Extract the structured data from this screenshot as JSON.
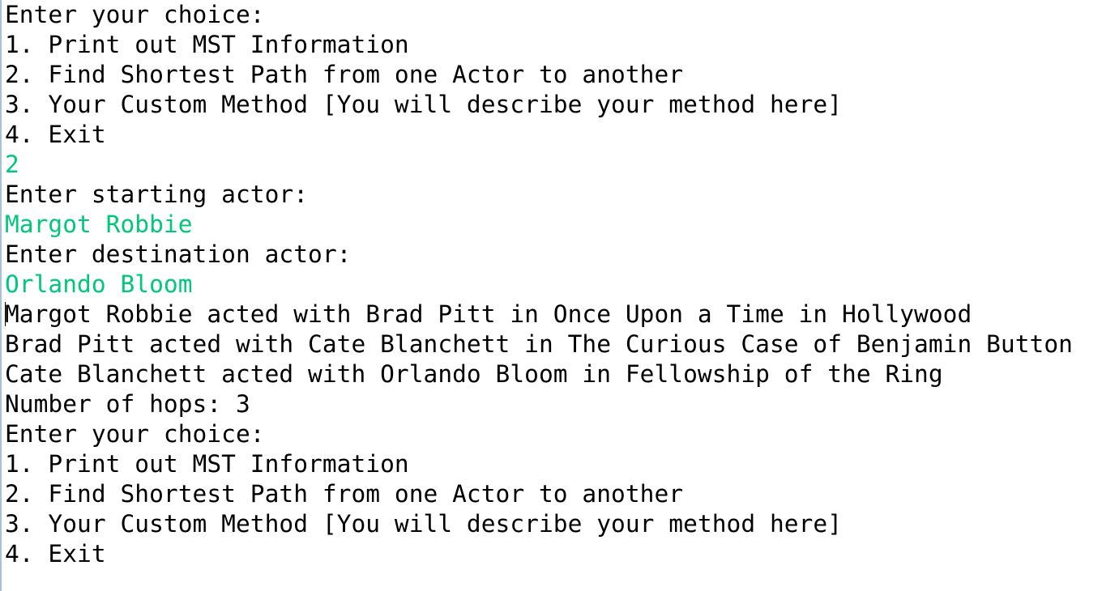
{
  "colors": {
    "output_text": "#000000",
    "user_input": "#00c87a",
    "background": "#ffffff",
    "left_border": "#a7c1d9"
  },
  "console": {
    "lines": [
      {
        "text": "Enter your choice:",
        "kind": "output"
      },
      {
        "text": "1. Print out MST Information",
        "kind": "output"
      },
      {
        "text": "2. Find Shortest Path from one Actor to another",
        "kind": "output"
      },
      {
        "text": "3. Your Custom Method [You will describe your method here]",
        "kind": "output"
      },
      {
        "text": "4. Exit",
        "kind": "output"
      },
      {
        "text": "2",
        "kind": "input"
      },
      {
        "text": "Enter starting actor:",
        "kind": "output"
      },
      {
        "text": "Margot Robbie",
        "kind": "input"
      },
      {
        "text": "Enter destination actor:",
        "kind": "output"
      },
      {
        "text": "Orlando Bloom",
        "kind": "input"
      },
      {
        "text": "Margot Robbie acted with Brad Pitt in Once Upon a Time in Hollywood",
        "kind": "output"
      },
      {
        "text": "Brad Pitt acted with Cate Blanchett in The Curious Case of Benjamin Button",
        "kind": "output"
      },
      {
        "text": "Cate Blanchett acted with Orlando Bloom in Fellowship of the Ring",
        "kind": "output"
      },
      {
        "text": "Number of hops: 3",
        "kind": "output"
      },
      {
        "text": "Enter your choice:",
        "kind": "output"
      },
      {
        "text": "1. Print out MST Information",
        "kind": "output"
      },
      {
        "text": "2. Find Shortest Path from one Actor to another",
        "kind": "output"
      },
      {
        "text": "3. Your Custom Method [You will describe your method here]",
        "kind": "output"
      },
      {
        "text": "4. Exit",
        "kind": "output"
      }
    ]
  }
}
